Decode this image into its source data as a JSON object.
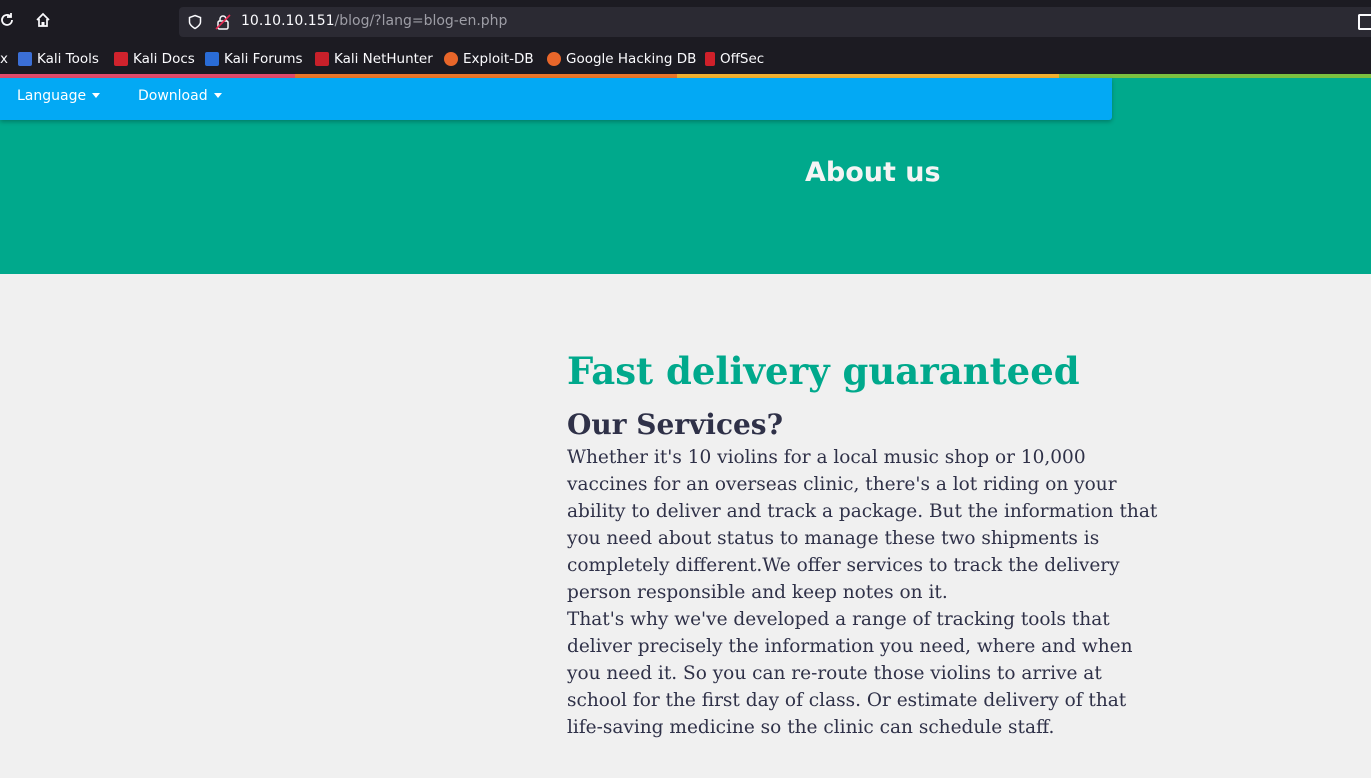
{
  "browser": {
    "url_host": "10.10.10.151",
    "url_path": "/blog/?lang=blog-en.php",
    "bookmarks": [
      {
        "label": "Kali Tools",
        "color": "#3b6fd6"
      },
      {
        "label": "Kali Docs",
        "color": "#d0232d"
      },
      {
        "label": "Kali Forums",
        "color": "#2a6cd6"
      },
      {
        "label": "Kali NetHunter",
        "color": "#c8202a"
      },
      {
        "label": "Exploit-DB",
        "color": "#e8662a"
      },
      {
        "label": "Google Hacking DB",
        "color": "#e8662a"
      },
      {
        "label": "OffSec",
        "color": "#d0202a"
      }
    ],
    "truncated_left_label": "x",
    "icons": [
      "reload-icon",
      "home-icon",
      "shield-icon",
      "insecure-lock-icon",
      "sidebar-icon"
    ]
  },
  "nav": {
    "items": [
      {
        "label": "Language"
      },
      {
        "label": "Download"
      }
    ]
  },
  "hero": {
    "title": "About us"
  },
  "main": {
    "heading": "Fast delivery guaranteed",
    "subheading": "Our Services?",
    "paragraph1": "Whether it's 10 violins for a local music shop or 10,000 vaccines for an overseas clinic, there's a lot riding on your ability to deliver and track a package. But the information that you need about status to manage these two shipments is completely different.We offer services to track the delivery person responsible and keep notes on it.",
    "paragraph2": "That's why we've developed a range of tracking tools that deliver precisely the information you need, where and when you need it. So you can re-route those violins to arrive at school for the first day of class. Or estimate delivery of that life-saving medicine so the clinic can schedule staff."
  },
  "colors": {
    "hero_bg": "#00a98c",
    "navbar_bg": "#03a9f4",
    "heading": "#00a98c",
    "text": "#2f3148",
    "page_bg": "#f0f0f0"
  }
}
